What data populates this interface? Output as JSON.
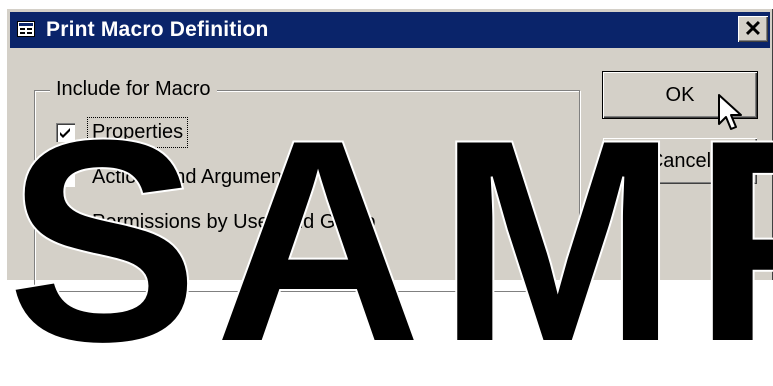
{
  "window": {
    "title": "Print Macro Definition",
    "close_label": "✕"
  },
  "group": {
    "label": "Include for Macro",
    "options": [
      {
        "label": "Properties",
        "checked": true
      },
      {
        "label": "Actions and Arguments",
        "checked": true
      },
      {
        "label": "Permissions by User and Group",
        "checked": true
      }
    ]
  },
  "buttons": {
    "ok_label": "OK",
    "cancel_label": "Cancel"
  },
  "watermark": {
    "text": "SAMP"
  },
  "colors": {
    "title_bar": "#0a246a",
    "dialog_face": "#d4d0c8"
  },
  "icons": {
    "window_icon": "macro-window-icon",
    "cursor": "mouse-pointer-icon"
  }
}
